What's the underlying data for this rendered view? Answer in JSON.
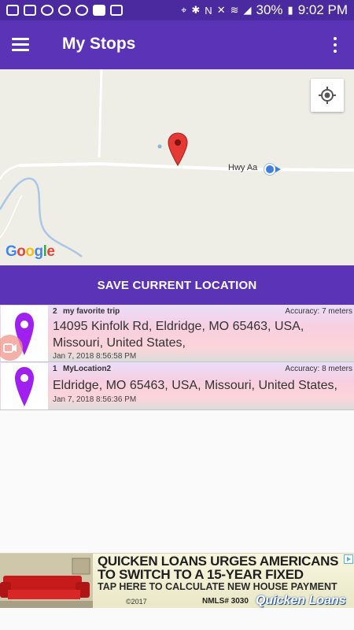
{
  "status_bar": {
    "battery": "30%",
    "time": "9:02 PM"
  },
  "app_bar": {
    "title": "My Stops"
  },
  "map": {
    "road_label": "Hwy Aa",
    "logo": "Google"
  },
  "save_button": {
    "label": "SAVE CURRENT LOCATION"
  },
  "stops": [
    {
      "index": "2",
      "name": "my favorite trip",
      "accuracy": "Accuracy: 7 meters",
      "address": "14095 Kinfolk Rd, Eldridge, MO 65463, USA, Missouri, United States,",
      "date": "Jan 7, 2018 8:56:58 PM"
    },
    {
      "index": "1",
      "name": "MyLocation2",
      "accuracy": "Accuracy: 8 meters",
      "address": "Eldridge, MO 65463, USA, Missouri, United States,",
      "date": "Jan 7, 2018 8:56:36 PM"
    }
  ],
  "ad": {
    "line1": "QUICKEN LOANS URGES AMERICANS",
    "line2": "TO SWITCH TO A 15-YEAR FIXED",
    "line3": "TAP HERE TO CALCULATE NEW HOUSE PAYMENT",
    "copyright": "©2017",
    "nmls": "NMLS# 3030",
    "brand": "Quicken Loans"
  },
  "colors": {
    "primary": "#5b33b7",
    "status_bar": "#4a2a9e",
    "pin_purple": "#a020f0",
    "map_pin_red": "#e53935"
  }
}
